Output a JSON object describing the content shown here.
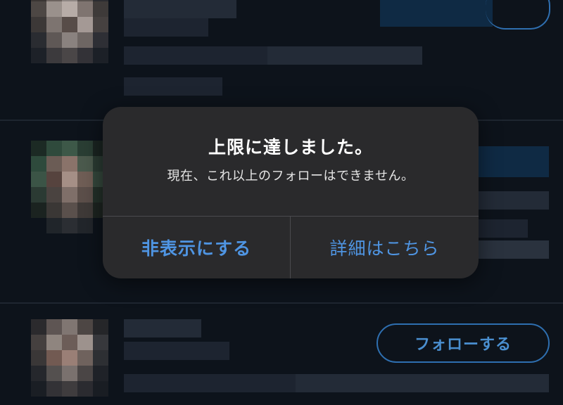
{
  "alert": {
    "title": "上限に達しました。",
    "message": "現在、これ以上のフォローはできません。",
    "buttons": {
      "hide_label": "非表示にする",
      "details_label": "詳細はこちら"
    }
  },
  "list": {
    "follow_button_label": "フォローする"
  },
  "colors": {
    "background": "#0d131b",
    "alert_background": "#2a2a2c",
    "accent_blue": "#4f95e3",
    "follow_outline": "#2e6fb0"
  }
}
